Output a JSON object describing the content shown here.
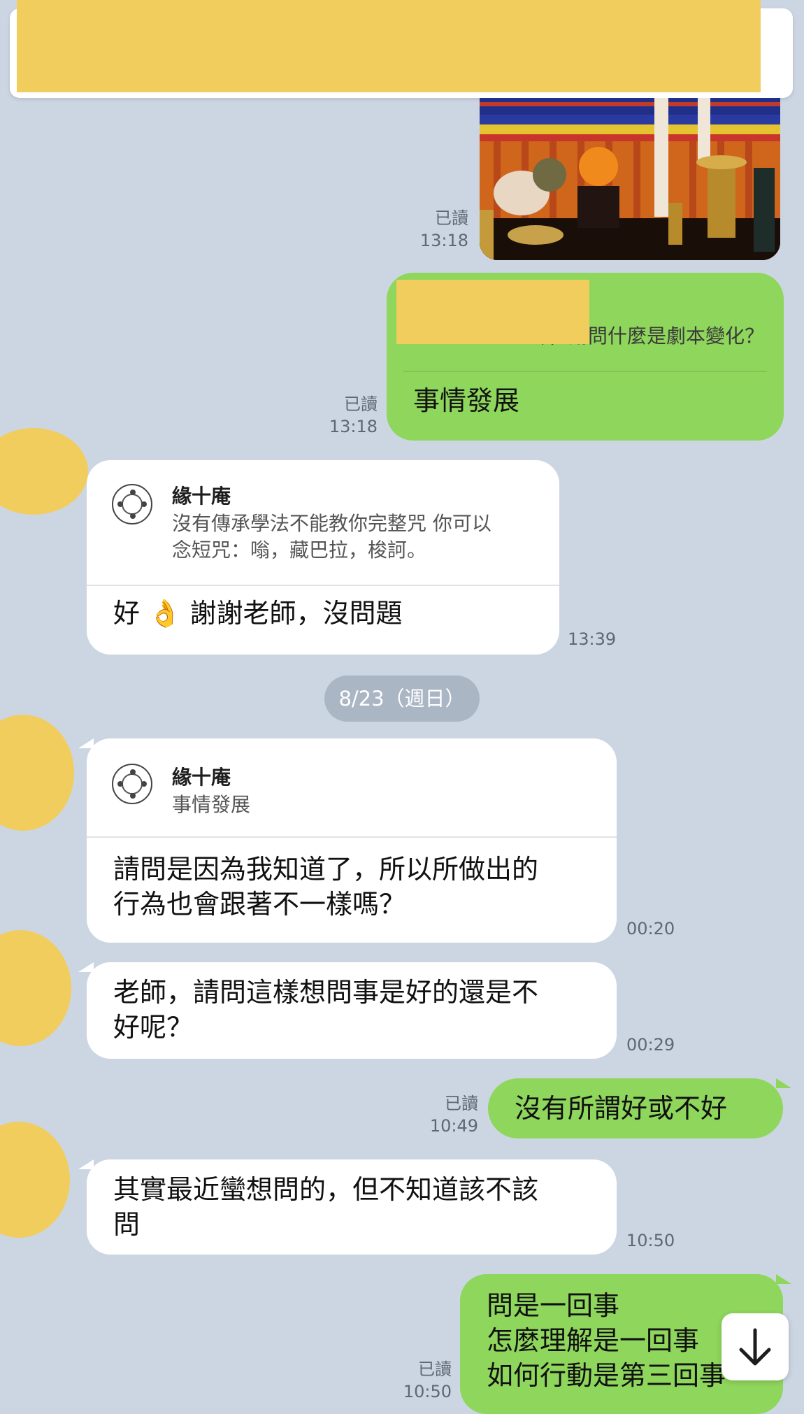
{
  "messages": {
    "m1": {
      "receipt": "已讀",
      "time": "13:18"
    },
    "m2": {
      "quote_text": "老師，請問什麼是劇本變化？",
      "text": "事情發展",
      "receipt": "已讀",
      "time": "13:18"
    },
    "m3": {
      "quote_name": "緣十庵",
      "quote_text_line1": "沒有傳承學法不能教你完整咒 你可以",
      "quote_text_line2": "念短咒：嗡，藏巴拉，梭訶。",
      "text_prefix": "好",
      "emoji": "👌",
      "text_suffix": "謝謝老師，沒問題",
      "time": "13:39"
    },
    "date_separator": "8/23（週日）",
    "m4": {
      "quote_name": "緣十庵",
      "quote_text": "事情發展",
      "text_line1": "請問是因為我知道了，所以所做出的",
      "text_line2": "行為也會跟著不一樣嗎？",
      "time": "00:20"
    },
    "m5": {
      "text_line1": "老師，請問這樣想問事是好的還是不",
      "text_line2": "好呢？",
      "time": "00:29"
    },
    "m6": {
      "text": "沒有所謂好或不好",
      "receipt": "已讀",
      "time": "10:49"
    },
    "m7": {
      "text_line1": "其實最近蠻想問的，但不知道該不該",
      "text_line2": "問",
      "time": "10:50"
    },
    "m8": {
      "text_line1": "問是一回事",
      "text_line2": "怎麼理解是一回事",
      "text_line3": "如何行動是第三回事",
      "receipt": "已讀",
      "time": "10:50"
    }
  },
  "colors": {
    "background": "#ccd6e2",
    "sent_bubble": "#8fd65c",
    "received_bubble": "#ffffff",
    "redaction": "#f1cd5e"
  },
  "icons": {
    "scroll_down": "arrow-down-icon",
    "sender_logo": "temple-logo-icon"
  }
}
